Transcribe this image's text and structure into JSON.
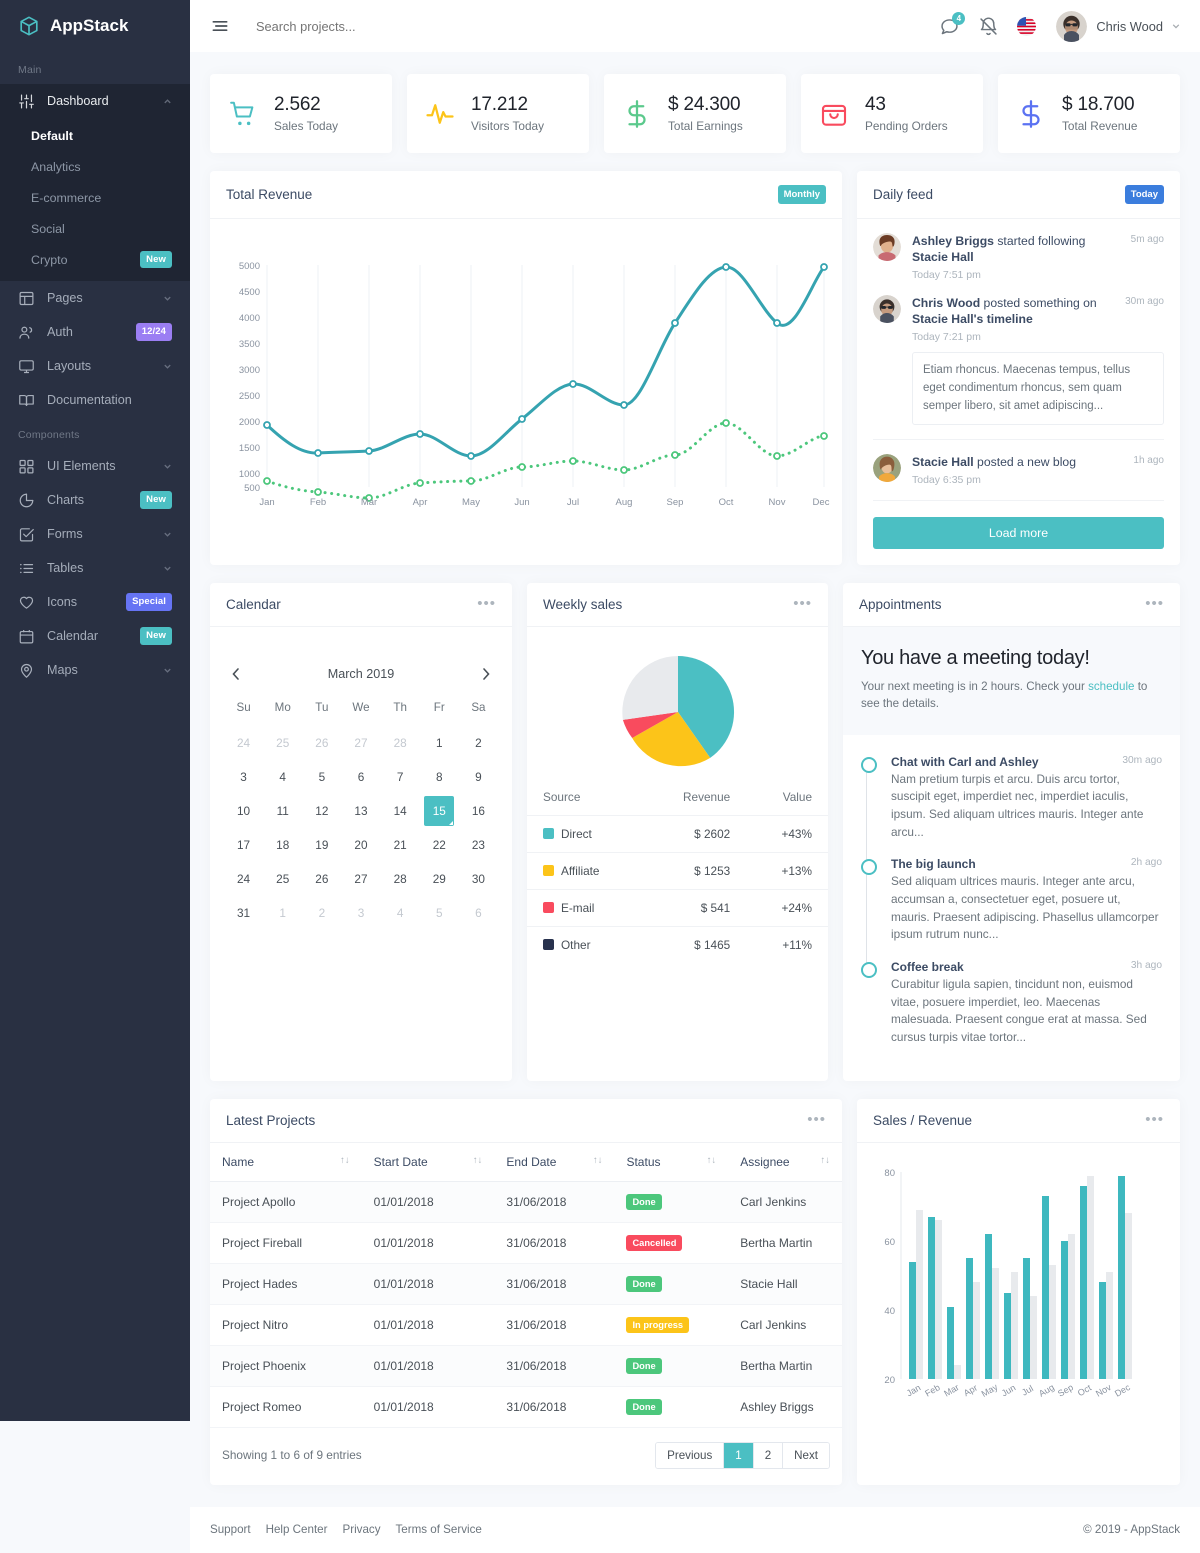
{
  "brand": {
    "name": "AppStack",
    "logo_icon": "cube-icon",
    "accent": "#4bbfc3"
  },
  "sidebar": {
    "sections": [
      {
        "label": "Main"
      },
      {
        "label": "Components"
      }
    ],
    "main_items": [
      {
        "label": "Dashboard",
        "icon": "sliders-icon",
        "expanded": true,
        "children": [
          {
            "label": "Default",
            "active": true
          },
          {
            "label": "Analytics"
          },
          {
            "label": "E-commerce"
          },
          {
            "label": "Social"
          },
          {
            "label": "Crypto",
            "badge": "New",
            "badge_color": "#4bbfc3"
          }
        ]
      },
      {
        "label": "Pages",
        "icon": "layout-icon"
      },
      {
        "label": "Auth",
        "icon": "users-icon",
        "badge": "12/24",
        "badge_color": "#9b7ef3"
      },
      {
        "label": "Layouts",
        "icon": "monitor-icon"
      },
      {
        "label": "Documentation",
        "icon": "book-icon"
      }
    ],
    "component_items": [
      {
        "label": "UI Elements",
        "icon": "grid-icon"
      },
      {
        "label": "Charts",
        "icon": "pie-chart-icon",
        "badge": "New",
        "badge_color": "#4bbfc3"
      },
      {
        "label": "Forms",
        "icon": "check-square-icon"
      },
      {
        "label": "Tables",
        "icon": "list-icon"
      },
      {
        "label": "Icons",
        "icon": "heart-icon",
        "badge": "Special",
        "badge_color": "#6674f4"
      },
      {
        "label": "Calendar",
        "icon": "calendar-icon",
        "badge": "New",
        "badge_color": "#4bbfc3"
      },
      {
        "label": "Maps",
        "icon": "map-pin-icon"
      }
    ]
  },
  "navbar": {
    "toggle_icon": "hamburger-icon",
    "search_placeholder": "Search projects...",
    "messages_icon": "message-icon",
    "messages_count": "4",
    "bell_icon": "bell-off-icon",
    "flag_icon": "us-flag-icon",
    "user_name": "Chris Wood",
    "chevron_icon": "chevron-down-icon"
  },
  "stats": [
    {
      "value": "2.562",
      "label": "Sales Today",
      "icon": "shopping-cart-icon",
      "color": "#4bbfc3"
    },
    {
      "value": "17.212",
      "label": "Visitors Today",
      "icon": "activity-icon",
      "color": "#fcc419"
    },
    {
      "value": "$ 24.300",
      "label": "Total Earnings",
      "icon": "dollar-sign-icon",
      "color": "#5bc98c"
    },
    {
      "value": "43",
      "label": "Pending Orders",
      "icon": "shopping-bag-icon",
      "color": "#f94b5e"
    },
    {
      "value": "$ 18.700",
      "label": "Total Revenue",
      "icon": "dollar-sign-icon",
      "color": "#5b72f2"
    }
  ],
  "revenue_card": {
    "title": "Total Revenue",
    "badge": "Monthly",
    "badge_color": "#4bbfc3"
  },
  "daily_feed": {
    "title": "Daily feed",
    "badge": "Today",
    "badge_color": "#3b7ddd",
    "load_more": "Load more",
    "items": [
      {
        "actor": "Ashley Briggs",
        "action": " started following ",
        "target": "Stacie Hall",
        "ago": "5m ago",
        "time": "Today 7:51 pm",
        "quote": null
      },
      {
        "actor": "Chris Wood",
        "action": " posted something on ",
        "target": "Stacie Hall's timeline",
        "ago": "30m ago",
        "time": "Today 7:21 pm",
        "quote": "Etiam rhoncus. Maecenas tempus, tellus eget condimentum rhoncus, sem quam semper libero, sit amet adipiscing..."
      },
      {
        "actor": "Stacie Hall",
        "action": " posted a new blog",
        "target": "",
        "ago": "1h ago",
        "time": "Today 6:35 pm",
        "quote": null
      }
    ]
  },
  "calendar": {
    "title": "Calendar",
    "month": "March 2019",
    "prev_icon": "chevron-left-icon",
    "next_icon": "chevron-right-icon",
    "weekdays": [
      "Su",
      "Mo",
      "Tu",
      "We",
      "Th",
      "Fr",
      "Sa"
    ],
    "selected_day": 15,
    "weeks": [
      [
        {
          "d": "24",
          "mut": true
        },
        {
          "d": "25",
          "mut": true
        },
        {
          "d": "26",
          "mut": true
        },
        {
          "d": "27",
          "mut": true
        },
        {
          "d": "28",
          "mut": true
        },
        {
          "d": "1"
        },
        {
          "d": "2"
        }
      ],
      [
        {
          "d": "3"
        },
        {
          "d": "4"
        },
        {
          "d": "5"
        },
        {
          "d": "6"
        },
        {
          "d": "7"
        },
        {
          "d": "8"
        },
        {
          "d": "9"
        }
      ],
      [
        {
          "d": "10"
        },
        {
          "d": "11"
        },
        {
          "d": "12"
        },
        {
          "d": "13"
        },
        {
          "d": "14"
        },
        {
          "d": "15",
          "sel": true
        },
        {
          "d": "16"
        }
      ],
      [
        {
          "d": "17"
        },
        {
          "d": "18"
        },
        {
          "d": "19"
        },
        {
          "d": "20"
        },
        {
          "d": "21"
        },
        {
          "d": "22"
        },
        {
          "d": "23"
        }
      ],
      [
        {
          "d": "24"
        },
        {
          "d": "25"
        },
        {
          "d": "26"
        },
        {
          "d": "27"
        },
        {
          "d": "28"
        },
        {
          "d": "29"
        },
        {
          "d": "30"
        }
      ],
      [
        {
          "d": "31"
        },
        {
          "d": "1",
          "mut": true
        },
        {
          "d": "2",
          "mut": true
        },
        {
          "d": "3",
          "mut": true
        },
        {
          "d": "4",
          "mut": true
        },
        {
          "d": "5",
          "mut": true
        },
        {
          "d": "6",
          "mut": true
        }
      ]
    ]
  },
  "weekly_sales": {
    "title": "Weekly sales",
    "columns": [
      "Source",
      "Revenue",
      "Value"
    ],
    "rows": [
      {
        "source": "Direct",
        "revenue": "$ 2602",
        "value": "+43%",
        "color": "#4bbfc3"
      },
      {
        "source": "Affiliate",
        "revenue": "$ 1253",
        "value": "+13%",
        "color": "#fcc419"
      },
      {
        "source": "E-mail",
        "revenue": "$ 541",
        "value": "+24%",
        "color": "#f94b5e"
      },
      {
        "source": "Other",
        "revenue": "$ 1465",
        "value": "+11%",
        "color": "#28324e"
      }
    ]
  },
  "appointments": {
    "title": "Appointments",
    "hero_title": "You have a meeting today!",
    "hero_text_before": "Your next meeting is in 2 hours. Check your ",
    "hero_link": "schedule",
    "hero_text_after": " to see the details.",
    "items": [
      {
        "title": "Chat with Carl and Ashley",
        "ago": "30m ago",
        "body": "Nam pretium turpis et arcu. Duis arcu tortor, suscipit eget, imperdiet nec, imperdiet iaculis, ipsum. Sed aliquam ultrices mauris. Integer ante arcu..."
      },
      {
        "title": "The big launch",
        "ago": "2h ago",
        "body": "Sed aliquam ultrices mauris. Integer ante arcu, accumsan a, consectetuer eget, posuere ut, mauris. Praesent adipiscing. Phasellus ullamcorper ipsum rutrum nunc..."
      },
      {
        "title": "Coffee break",
        "ago": "3h ago",
        "body": "Curabitur ligula sapien, tincidunt non, euismod vitae, posuere imperdiet, leo. Maecenas malesuada. Praesent congue erat at massa. Sed cursus turpis vitae tortor..."
      }
    ]
  },
  "projects": {
    "title": "Latest Projects",
    "columns": [
      "Name",
      "Start Date",
      "End Date",
      "Status",
      "Assignee"
    ],
    "rows": [
      {
        "name": "Project Apollo",
        "start": "01/01/2018",
        "end": "31/06/2018",
        "status": "Done",
        "status_color": "#4cc77c",
        "assignee": "Carl Jenkins"
      },
      {
        "name": "Project Fireball",
        "start": "01/01/2018",
        "end": "31/06/2018",
        "status": "Cancelled",
        "status_color": "#f94b5e",
        "assignee": "Bertha Martin"
      },
      {
        "name": "Project Hades",
        "start": "01/01/2018",
        "end": "31/06/2018",
        "status": "Done",
        "status_color": "#4cc77c",
        "assignee": "Stacie Hall"
      },
      {
        "name": "Project Nitro",
        "start": "01/01/2018",
        "end": "31/06/2018",
        "status": "In progress",
        "status_color": "#fcc419",
        "assignee": "Carl Jenkins"
      },
      {
        "name": "Project Phoenix",
        "start": "01/01/2018",
        "end": "31/06/2018",
        "status": "Done",
        "status_color": "#4cc77c",
        "assignee": "Bertha Martin"
      },
      {
        "name": "Project Romeo",
        "start": "01/01/2018",
        "end": "31/06/2018",
        "status": "Done",
        "status_color": "#4cc77c",
        "assignee": "Ashley Briggs"
      }
    ],
    "footer_info": "Showing 1 to 6 of 9 entries",
    "pager": {
      "previous": "Previous",
      "pages": [
        "1",
        "2"
      ],
      "current": "1",
      "next": "Next"
    }
  },
  "sales_revenue": {
    "title": "Sales / Revenue"
  },
  "footer": {
    "links": [
      "Support",
      "Help Center",
      "Privacy",
      "Terms of Service"
    ],
    "copyright": "© 2019 - AppStack"
  },
  "chart_data": [
    {
      "type": "line",
      "title": "Total Revenue",
      "categories": [
        "Jan",
        "Feb",
        "Mar",
        "Apr",
        "May",
        "Jun",
        "Jul",
        "Aug",
        "Sep",
        "Oct",
        "Nov",
        "Dec"
      ],
      "series": [
        {
          "name": "Revenue",
          "style": "solid",
          "color": "#35a3b0",
          "values": [
            2000,
            1450,
            1480,
            1790,
            1370,
            2100,
            2870,
            2520,
            3880,
            4950,
            3900,
            4930
          ]
        },
        {
          "name": "Target",
          "style": "dotted",
          "color": "#4cc77c",
          "values": [
            920,
            720,
            610,
            890,
            920,
            1190,
            1390,
            1220,
            1510,
            2090,
            1490,
            1870
          ]
        }
      ],
      "ylim": [
        500,
        5000
      ],
      "yticks": [
        500,
        1000,
        1500,
        2000,
        2500,
        3000,
        3500,
        4000,
        4500,
        5000
      ],
      "xlabel": "",
      "ylabel": "",
      "grid": true,
      "legend": false
    },
    {
      "type": "pie",
      "title": "Weekly sales",
      "labels": [
        "Direct",
        "Affiliate",
        "E-mail",
        "Other"
      ],
      "values": [
        2602,
        1253,
        541,
        1465
      ],
      "percents": [
        43,
        21,
        9,
        27
      ],
      "colors": [
        "#4bbfc3",
        "#fcc419",
        "#f94b5e",
        "#e8eaed"
      ],
      "legend": "table"
    },
    {
      "type": "bar",
      "title": "Sales / Revenue",
      "categories": [
        "Jan",
        "Feb",
        "Mar",
        "Apr",
        "May",
        "Jun",
        "Jul",
        "Aug",
        "Sep",
        "Oct",
        "Nov",
        "Dec"
      ],
      "series": [
        {
          "name": "Sales",
          "color": "#3eb8bf",
          "values": [
            54,
            67,
            41,
            55,
            62,
            45,
            55,
            73,
            60,
            76,
            48,
            79
          ]
        },
        {
          "name": "Revenue",
          "color": "#e8eaed",
          "values": [
            69,
            66,
            24,
            48,
            52,
            51,
            44,
            53,
            62,
            79,
            51,
            68
          ]
        }
      ],
      "ylim": [
        20,
        80
      ],
      "yticks": [
        20,
        40,
        60,
        80
      ],
      "xlabel": "",
      "ylabel": "",
      "grid": false,
      "legend": false
    }
  ]
}
